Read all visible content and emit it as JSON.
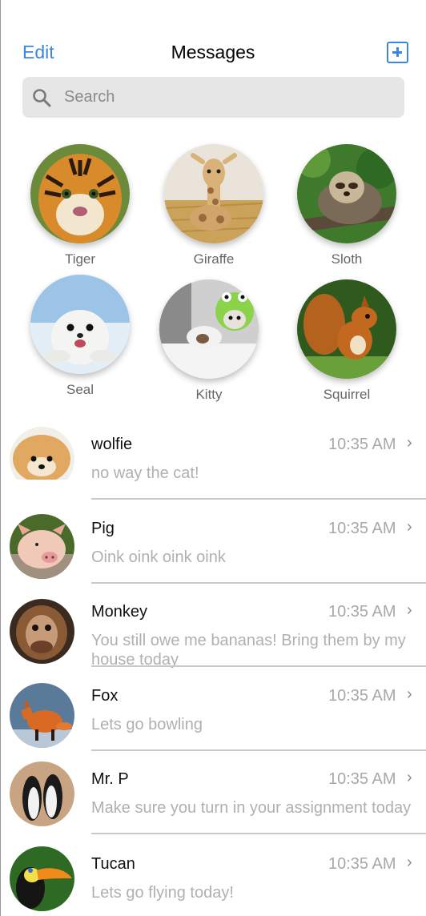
{
  "header": {
    "edit_label": "Edit",
    "title": "Messages",
    "compose_icon": "compose-plus-icon"
  },
  "search": {
    "placeholder": "Search",
    "icon": "search-icon"
  },
  "favorites": [
    {
      "name": "Tiger"
    },
    {
      "name": "Giraffe"
    },
    {
      "name": "Sloth"
    },
    {
      "name": "Seal"
    },
    {
      "name": "Kitty"
    },
    {
      "name": "Squirrel"
    }
  ],
  "conversations": [
    {
      "name": "wolfie",
      "time": "10:35 AM",
      "message": "no way the cat!"
    },
    {
      "name": "Pig",
      "time": "10:35 AM",
      "message": "Oink oink oink oink"
    },
    {
      "name": "Monkey",
      "time": "10:35 AM",
      "message": "You still owe me bananas! Bring them by my house today"
    },
    {
      "name": "Fox",
      "time": "10:35 AM",
      "message": "Lets go bowling"
    },
    {
      "name": "Mr. P",
      "time": "10:35 AM",
      "message": "Make sure you turn in your assignment today"
    },
    {
      "name": "Tucan",
      "time": "10:35 AM",
      "message": "Lets go flying today!"
    }
  ],
  "colors": {
    "accent": "#3a86e0",
    "secondary_text": "#a8a8a8",
    "search_bg": "#e6e6e6"
  }
}
